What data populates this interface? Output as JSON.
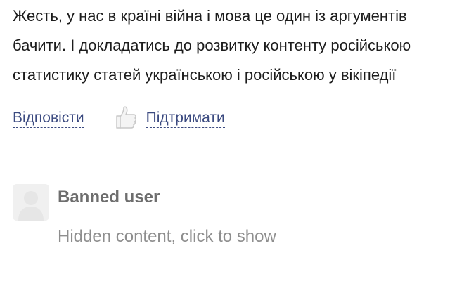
{
  "comment": {
    "lines": [
      "Жесть, у нас в країні війна і мова це один із аргументів",
      "бачити. І докладатись до розвитку контенту російською",
      "статистику статей українською і російською у вікіпедії"
    ]
  },
  "actions": {
    "reply_label": "Відповісти",
    "support_label": "Підтримати",
    "like_icon": "thumbs-up-icon"
  },
  "banned_comment": {
    "avatar_icon": "user-silhouette-icon",
    "name": "Banned user",
    "hidden_text": "Hidden content, click to show"
  }
}
